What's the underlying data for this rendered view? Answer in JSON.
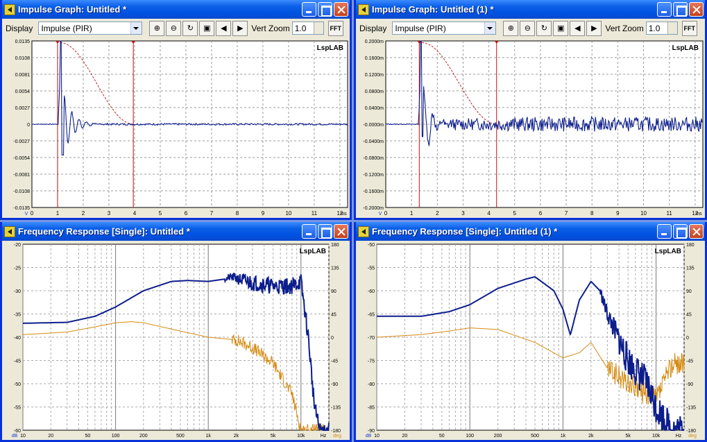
{
  "windows": {
    "imp1": {
      "title": "Impulse Graph: Untitled *"
    },
    "imp2": {
      "title": "Impulse Graph: Untitled (1) *"
    },
    "fr1": {
      "title": "Frequency Response [Single]: Untitled *"
    },
    "fr2": {
      "title": "Frequency Response [Single]: Untitled (1) *"
    }
  },
  "toolbar": {
    "display_label": "Display",
    "display_value": "Impulse (PIR)",
    "vert_zoom_label": "Vert Zoom",
    "vert_zoom_value": "1.0",
    "fft_label": "FFT"
  },
  "watermark": "LspLAB",
  "icons": [
    "speaker-icon",
    "minimize-icon",
    "maximize-icon",
    "close-icon",
    "zoom-in-icon",
    "zoom-out-icon",
    "zoom-reset-icon",
    "zoom-fit-icon",
    "prev-icon",
    "next-icon"
  ],
  "colors": {
    "titlebar": "#0a5fe6",
    "magnitude": "#0d1e8c",
    "phase": "#d48a10",
    "window_marker": "#c01010",
    "envelope": "#c02020"
  },
  "chart_data": [
    {
      "type": "line",
      "xlabel": "ms",
      "ylabel": "V",
      "xlim": [
        0,
        12.3
      ],
      "ylim": [
        -0.0135,
        0.0135
      ],
      "xticks": [
        "0",
        "1",
        "2",
        "3",
        "4",
        "5",
        "6",
        "7",
        "8",
        "9",
        "10",
        "11",
        "12"
      ],
      "yticks": [
        "0.0135",
        "0.0108",
        "0.0081",
        "0.0054",
        "0.0027",
        "0",
        "-0.0027",
        "-0.0054",
        "-0.0081",
        "-0.0108",
        "-0.0135"
      ],
      "markers_ms": [
        1.0,
        3.95
      ],
      "series": [
        {
          "values_ms_peak": [
            1.1,
            0.0135
          ],
          "values_ms_trough": [
            1.2,
            -0.005
          ]
        }
      ]
    },
    {
      "type": "line",
      "xlabel": "ms",
      "ylabel": "V",
      "xlim": [
        0,
        12.3
      ],
      "ylim": [
        -0.2,
        0.2
      ],
      "xticks": [
        "0",
        "1",
        "2",
        "3",
        "4",
        "5",
        "6",
        "7",
        "8",
        "9",
        "10",
        "11",
        "12"
      ],
      "yticks": [
        "0.2000m",
        "0.1600m",
        "0.1200m",
        "0.0800m",
        "0.0400m",
        "-0.0000m",
        "-0.0400m",
        "-0.0800m",
        "-0.1200m",
        "-0.1600m",
        "-0.2000m"
      ],
      "markers_ms": [
        1.3,
        4.3
      ],
      "series": [
        {
          "values_ms_peak": [
            1.35,
            0.2
          ],
          "values_ms_trough": [
            1.4,
            -0.03
          ]
        }
      ]
    },
    {
      "type": "line",
      "xlabel": "Hz",
      "ylabel": "dB",
      "y2label": "deg",
      "x_scale": "log",
      "xlim": [
        10,
        20000
      ],
      "ylim": [
        -60,
        -20
      ],
      "y2lim": [
        -180,
        180
      ],
      "xticks": [
        "10",
        "20",
        "50",
        "100",
        "200",
        "500",
        "1k",
        "2k",
        "5k",
        "10k"
      ],
      "yticks": [
        "-20",
        "-25",
        "-30",
        "-35",
        "-40",
        "-45",
        "-50",
        "-55",
        "-60"
      ],
      "y2ticks": [
        "180",
        "135",
        "90",
        "45",
        "0",
        "-45",
        "-90",
        "-135",
        "-180"
      ],
      "series": [
        {
          "x": [
            10,
            30,
            60,
            100,
            200,
            400,
            600,
            1000,
            1500,
            1800,
            2500,
            5000,
            8000,
            10000,
            12000,
            14000,
            16000
          ],
          "values": [
            -37,
            -36.8,
            -35.5,
            -33.5,
            -30,
            -28,
            -27.8,
            -28,
            -27.5,
            -27,
            -28,
            -29,
            -29,
            -28,
            -40,
            -55,
            -60
          ]
        },
        {
          "x": [
            10,
            30,
            60,
            100,
            150,
            200,
            500,
            1000,
            2000,
            3000,
            5000,
            8000,
            10000
          ],
          "values_deg": [
            5,
            10,
            20,
            28,
            30,
            28,
            12,
            0,
            -5,
            -20,
            -50,
            -110,
            -180
          ]
        }
      ]
    },
    {
      "type": "line",
      "xlabel": "Hz",
      "ylabel": "dB",
      "y2label": "deg",
      "x_scale": "log",
      "xlim": [
        10,
        20000
      ],
      "ylim": [
        -90,
        -50
      ],
      "y2lim": [
        -180,
        180
      ],
      "xticks": [
        "10",
        "20",
        "50",
        "100",
        "200",
        "500",
        "1k",
        "2k",
        "5k",
        "10k"
      ],
      "yticks": [
        "-50",
        "-55",
        "-60",
        "-65",
        "-70",
        "-75",
        "-80",
        "-85",
        "-90"
      ],
      "y2ticks": [
        "180",
        "135",
        "90",
        "45",
        "0",
        "-45",
        "-90",
        "-135",
        "-180"
      ],
      "series": [
        {
          "x": [
            10,
            30,
            60,
            100,
            200,
            400,
            500,
            800,
            1000,
            1200,
            1500,
            2000,
            2500,
            3000,
            5000,
            8000,
            10000,
            15000
          ],
          "values": [
            -65.5,
            -65.5,
            -64.5,
            -63,
            -59.5,
            -57.5,
            -57,
            -60,
            -64,
            -69.5,
            -62,
            -58,
            -60,
            -65,
            -75,
            -80,
            -85,
            -90
          ]
        },
        {
          "x": [
            10,
            30,
            60,
            100,
            200,
            500,
            1000,
            1500,
            2000,
            3000,
            5000,
            10000,
            15000
          ],
          "values_deg": [
            0,
            5,
            12,
            18,
            15,
            -10,
            -40,
            -30,
            -10,
            -60,
            -90,
            -120,
            -50
          ]
        }
      ]
    }
  ]
}
